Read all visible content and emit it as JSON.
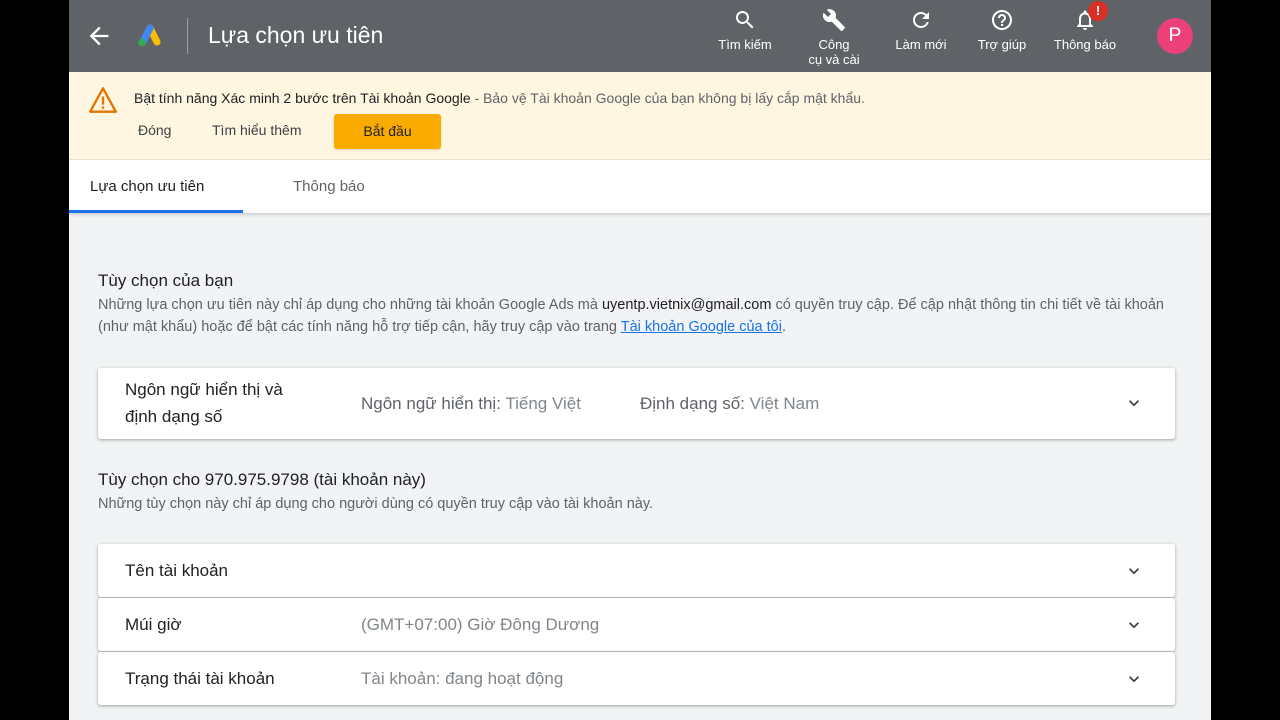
{
  "header": {
    "title": "Lựa chọn ưu tiên",
    "tools": [
      {
        "label": "Tìm kiếm",
        "icon": "search-icon"
      },
      {
        "label": "Công\ncụ và cài",
        "icon": "wrench-icon"
      },
      {
        "label": "Làm mới",
        "icon": "refresh-icon"
      },
      {
        "label": "Trợ giúp",
        "icon": "help-icon"
      },
      {
        "label": "Thông báo",
        "icon": "bell-icon"
      }
    ],
    "notification_badge": "!",
    "avatar_initial": "P"
  },
  "banner": {
    "headline": "Bật tính năng Xác minh 2 bước trên Tài khoản Google",
    "message": " - Bảo vệ Tài khoản Google của bạn không bị lấy cắp mật khẩu.",
    "close_label": "Đóng",
    "learn_label": "Tìm hiểu thêm",
    "start_label": "Bắt đầu"
  },
  "tabs": [
    {
      "label": "Lựa chọn ưu tiên",
      "active": true
    },
    {
      "label": "Thông báo",
      "active": false
    }
  ],
  "your_options": {
    "title": "Tùy chọn của bạn",
    "desc_before": "Những lựa chọn ưu tiên này chỉ áp dụng cho những tài khoản Google Ads mà ",
    "email": "uyentp.vietnix@gmail.com",
    "desc_after": " có quyền truy cập. Để cập nhật thông tin chi tiết về tài khoản (như mật khẩu) hoặc để bật các tính năng hỗ trợ tiếp cận, hãy truy cập vào trang ",
    "link": "Tài khoản Google của tôi",
    "period": ".",
    "language_card": {
      "label_line1": "Ngôn ngữ hiển thị và",
      "label_line2": "định dạng số",
      "lang_key": "Ngôn ngữ hiển thị:",
      "lang_val": " Tiếng Việt",
      "num_key": "Định dạng số:",
      "num_val": " Việt Nam"
    }
  },
  "account_options": {
    "title": "Tùy chọn cho 970.975.9798 (tài khoản này)",
    "desc": "Những tùy chọn này chỉ áp dụng cho người dùng có quyền truy cập vào tài khoản này.",
    "rows": [
      {
        "label": "Tên tài khoản",
        "value": ""
      },
      {
        "label": "Múi giờ",
        "value": "(GMT+07:00) Giờ Đông Dương"
      },
      {
        "label": "Trạng thái tài khoản",
        "value": "Tài khoản: đang hoạt động"
      }
    ]
  },
  "colors": {
    "topbar": "#5f6368",
    "banner_bg": "#fef6e0",
    "accent_button": "#f9ab00",
    "link": "#1a73e8",
    "avatar": "#ec407a",
    "badge": "#d93025"
  }
}
